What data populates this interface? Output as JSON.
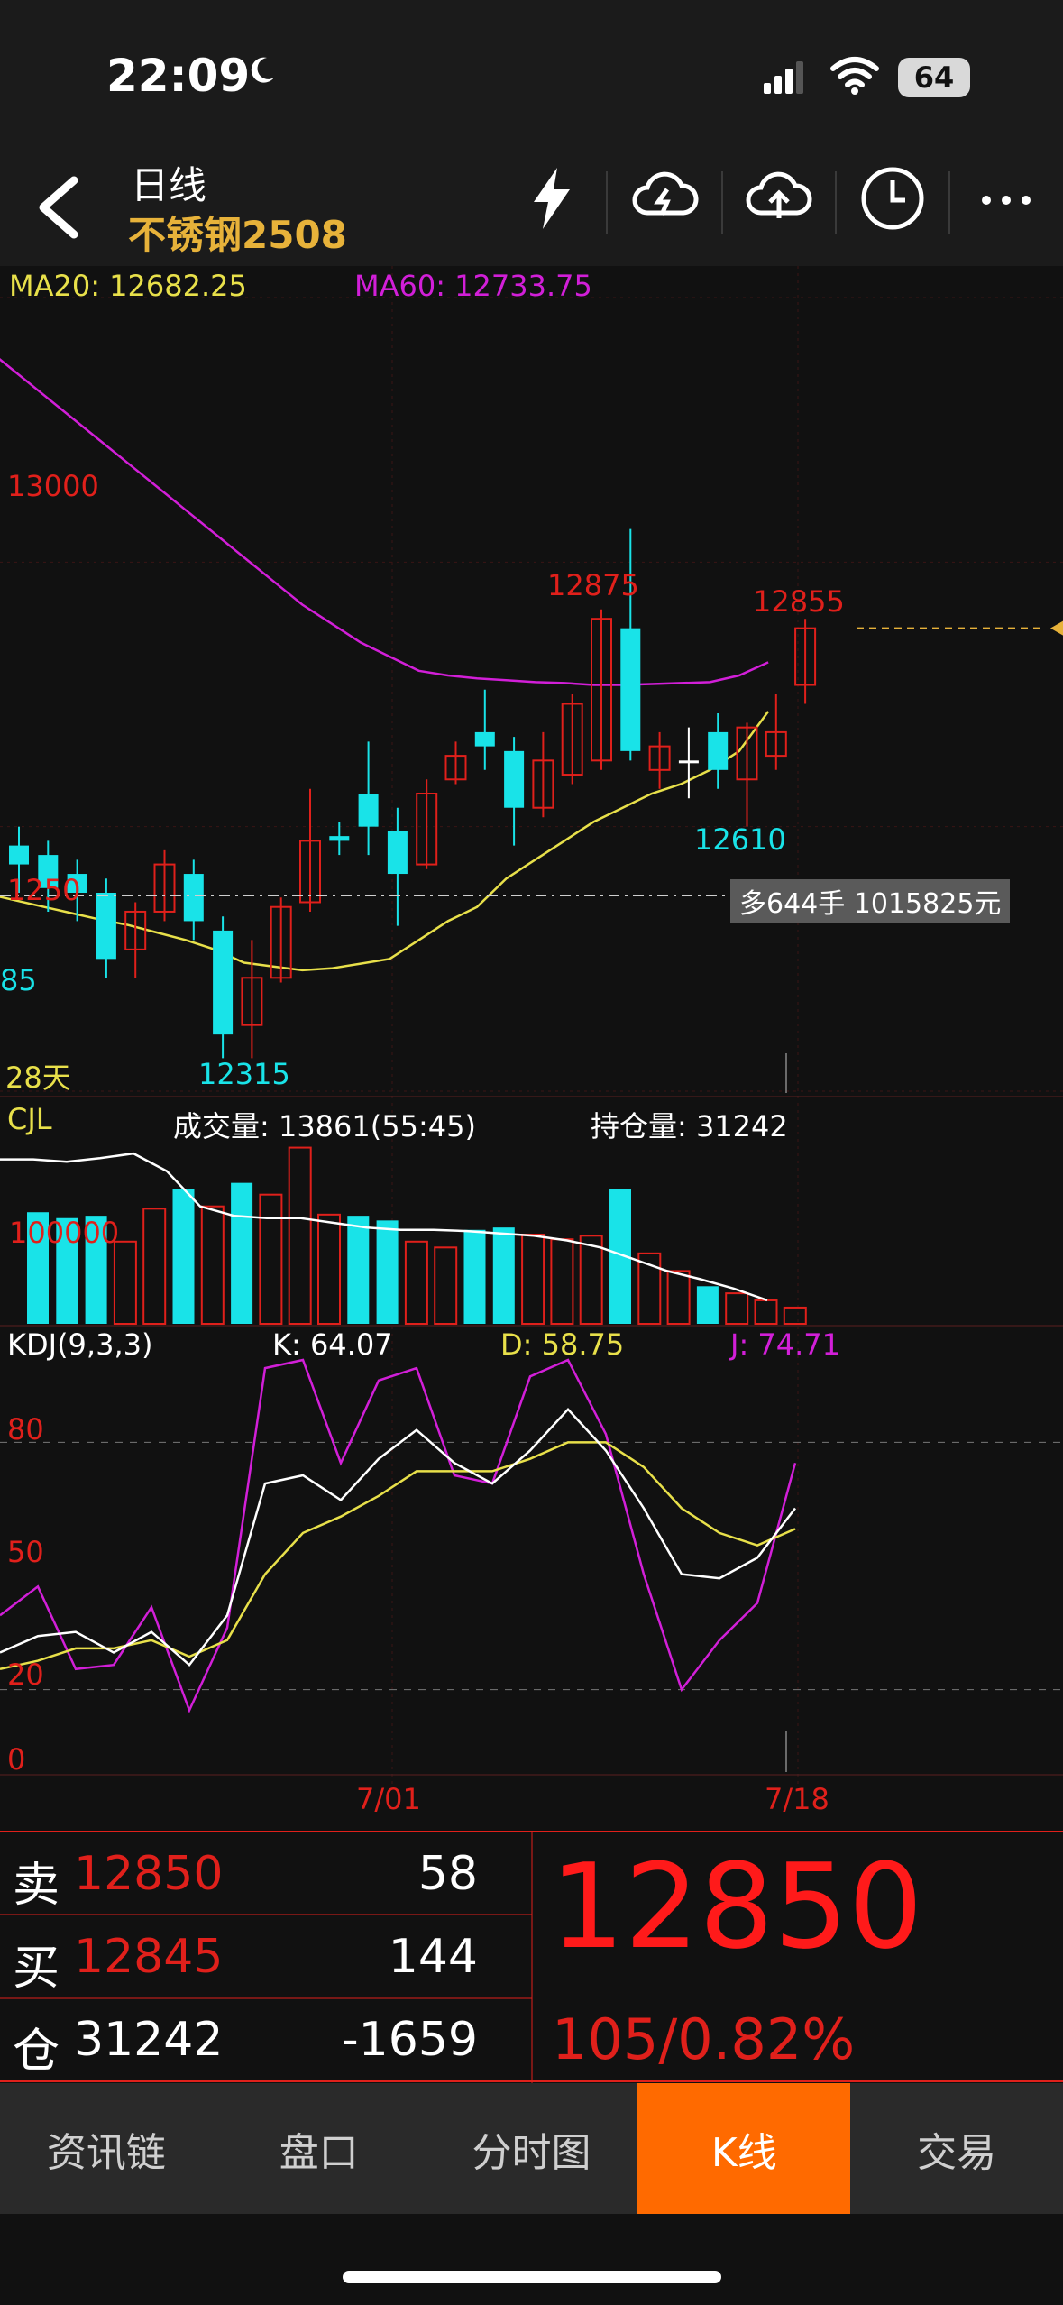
{
  "status": {
    "time": "22:09",
    "battery": "64"
  },
  "header": {
    "period": "日线",
    "instrument": "不锈钢2508"
  },
  "ma": {
    "ma20": "MA20: 12682.25",
    "ma60": "MA60: 12733.75"
  },
  "price_labels": {
    "p13000": "13000",
    "p12875": "12875",
    "p12855": "12855",
    "p12610": "12610",
    "p1250": "1250",
    "p85": "85",
    "p12315": "12315",
    "days": "28天",
    "position_tag": "多644手 1015825元"
  },
  "volume": {
    "label": "CJL",
    "volume": "成交量: 13861(55:45)",
    "oi": "持仓量: 31242",
    "tick": "100000"
  },
  "kdj": {
    "label": "KDJ(9,3,3)",
    "k": "K: 64.07",
    "d": "D: 58.75",
    "j": "J: 74.71",
    "ticks": [
      "80",
      "50",
      "20",
      "0"
    ]
  },
  "dates": {
    "d1": "7/01",
    "d2": "7/18"
  },
  "quote": {
    "sell_label": "卖",
    "sell_price": "12850",
    "sell_qty": "58",
    "buy_label": "买",
    "buy_price": "12845",
    "buy_qty": "144",
    "oi_label": "仓",
    "oi_value": "31242",
    "oi_change": "-1659",
    "last": "12850",
    "change": "105/0.82%"
  },
  "tabs": [
    "资讯链",
    "盘口",
    "分时图",
    "K线",
    "交易"
  ],
  "colors": {
    "up": "#e0201b",
    "down": "#19e3e8",
    "ma20": "#e8e04a",
    "ma60": "#d21fd8",
    "accent": "#ff6a00"
  },
  "chart_data": {
    "type": "candlestick",
    "candles": [
      {
        "o": 12540,
        "c": 12520,
        "h": 12560,
        "l": 12490,
        "dir": "down"
      },
      {
        "o": 12530,
        "c": 12495,
        "h": 12545,
        "l": 12470,
        "dir": "down"
      },
      {
        "o": 12510,
        "c": 12490,
        "h": 12525,
        "l": 12460,
        "dir": "down"
      },
      {
        "o": 12490,
        "c": 12420,
        "h": 12505,
        "l": 12400,
        "dir": "down"
      },
      {
        "o": 12430,
        "c": 12470,
        "h": 12480,
        "l": 12400,
        "dir": "up"
      },
      {
        "o": 12470,
        "c": 12520,
        "h": 12535,
        "l": 12460,
        "dir": "up"
      },
      {
        "o": 12510,
        "c": 12460,
        "h": 12525,
        "l": 12440,
        "dir": "down"
      },
      {
        "o": 12450,
        "c": 12340,
        "h": 12465,
        "l": 12315,
        "dir": "down"
      },
      {
        "o": 12350,
        "c": 12400,
        "h": 12440,
        "l": 12315,
        "dir": "up"
      },
      {
        "o": 12400,
        "c": 12475,
        "h": 12485,
        "l": 12395,
        "dir": "up"
      },
      {
        "o": 12480,
        "c": 12545,
        "h": 12600,
        "l": 12470,
        "dir": "up"
      },
      {
        "o": 12550,
        "c": 12545,
        "h": 12565,
        "l": 12530,
        "dir": "down"
      },
      {
        "o": 12595,
        "c": 12560,
        "h": 12650,
        "l": 12530,
        "dir": "down"
      },
      {
        "o": 12555,
        "c": 12510,
        "h": 12580,
        "l": 12455,
        "dir": "down"
      },
      {
        "o": 12520,
        "c": 12595,
        "h": 12610,
        "l": 12515,
        "dir": "up"
      },
      {
        "o": 12610,
        "c": 12635,
        "h": 12650,
        "l": 12605,
        "dir": "up"
      },
      {
        "o": 12660,
        "c": 12645,
        "h": 12705,
        "l": 12620,
        "dir": "down"
      },
      {
        "o": 12640,
        "c": 12580,
        "h": 12655,
        "l": 12540,
        "dir": "down"
      },
      {
        "o": 12580,
        "c": 12630,
        "h": 12660,
        "l": 12570,
        "dir": "up"
      },
      {
        "o": 12615,
        "c": 12690,
        "h": 12700,
        "l": 12605,
        "dir": "up"
      },
      {
        "o": 12630,
        "c": 12780,
        "h": 12790,
        "l": 12620,
        "dir": "up"
      },
      {
        "o": 12770,
        "c": 12640,
        "h": 12875,
        "l": 12630,
        "dir": "down"
      },
      {
        "o": 12620,
        "c": 12645,
        "h": 12660,
        "l": 12600,
        "dir": "up"
      },
      {
        "o": 12630,
        "c": 12630,
        "h": 12665,
        "l": 12590,
        "dir": "flat"
      },
      {
        "o": 12660,
        "c": 12620,
        "h": 12680,
        "l": 12600,
        "dir": "down"
      },
      {
        "o": 12610,
        "c": 12665,
        "h": 12670,
        "l": 12560,
        "dir": "up"
      },
      {
        "o": 12635,
        "c": 12660,
        "h": 12700,
        "l": 12620,
        "dir": "up"
      },
      {
        "o": 12710,
        "c": 12770,
        "h": 12780,
        "l": 12690,
        "dir": "up"
      }
    ],
    "ma20": [
      12490,
      12483,
      12476,
      12469,
      12462,
      12456,
      12448,
      12440,
      12430,
      12416,
      12412,
      12408,
      12410,
      12415,
      12420,
      12440,
      12460,
      12475,
      12505,
      12525,
      12545,
      12565,
      12580,
      12595,
      12605,
      12620,
      12640,
      12682
    ],
    "ma60": [
      13070,
      13045,
      13020,
      12995,
      12970,
      12945,
      12920,
      12895,
      12870,
      12845,
      12820,
      12795,
      12775,
      12755,
      12740,
      12725,
      12720,
      12717,
      12715,
      12713,
      12712,
      12710,
      12710,
      12711,
      12712,
      12713,
      12720,
      12734
    ],
    "volume": [
      {
        "v": 95000,
        "dir": "down"
      },
      {
        "v": 90000,
        "dir": "down"
      },
      {
        "v": 92000,
        "dir": "down"
      },
      {
        "v": 70000,
        "dir": "up"
      },
      {
        "v": 98000,
        "dir": "up"
      },
      {
        "v": 115000,
        "dir": "down"
      },
      {
        "v": 100000,
        "dir": "up"
      },
      {
        "v": 120000,
        "dir": "down"
      },
      {
        "v": 110000,
        "dir": "up"
      },
      {
        "v": 150000,
        "dir": "up"
      },
      {
        "v": 93000,
        "dir": "up"
      },
      {
        "v": 92000,
        "dir": "down"
      },
      {
        "v": 88000,
        "dir": "down"
      },
      {
        "v": 70000,
        "dir": "up"
      },
      {
        "v": 65000,
        "dir": "up"
      },
      {
        "v": 80000,
        "dir": "down"
      },
      {
        "v": 82000,
        "dir": "down"
      },
      {
        "v": 76000,
        "dir": "up"
      },
      {
        "v": 72000,
        "dir": "up"
      },
      {
        "v": 75000,
        "dir": "up"
      },
      {
        "v": 115000,
        "dir": "down"
      },
      {
        "v": 60000,
        "dir": "up"
      },
      {
        "v": 45000,
        "dir": "up"
      },
      {
        "v": 32000,
        "dir": "down"
      },
      {
        "v": 26000,
        "dir": "up"
      },
      {
        "v": 20000,
        "dir": "up"
      },
      {
        "v": 13861,
        "dir": "up"
      }
    ],
    "vol_ma": [
      140000,
      140000,
      138000,
      141000,
      145000,
      130000,
      100000,
      92000,
      90000,
      90000,
      86000,
      82000,
      80000,
      80000,
      79000,
      77000,
      75000,
      71000,
      65000,
      55000,
      45000,
      38000,
      30000,
      20000
    ],
    "kdj_k": [
      29,
      33,
      34,
      29,
      34,
      26,
      38,
      70,
      72,
      66,
      76,
      83,
      75,
      70,
      78,
      88,
      78,
      64,
      48,
      47,
      52,
      64
    ],
    "kdj_d": [
      25,
      27,
      30,
      30,
      32,
      28,
      32,
      48,
      58,
      62,
      67,
      73,
      73,
      73,
      76,
      80,
      80,
      74,
      64,
      58,
      55,
      59
    ],
    "kdj_j": [
      38,
      45,
      25,
      26,
      40,
      15,
      35,
      98,
      100,
      75,
      95,
      98,
      72,
      70,
      96,
      100,
      82,
      48,
      20,
      32,
      41,
      75
    ],
    "ylim": [
      12280,
      13120
    ]
  }
}
